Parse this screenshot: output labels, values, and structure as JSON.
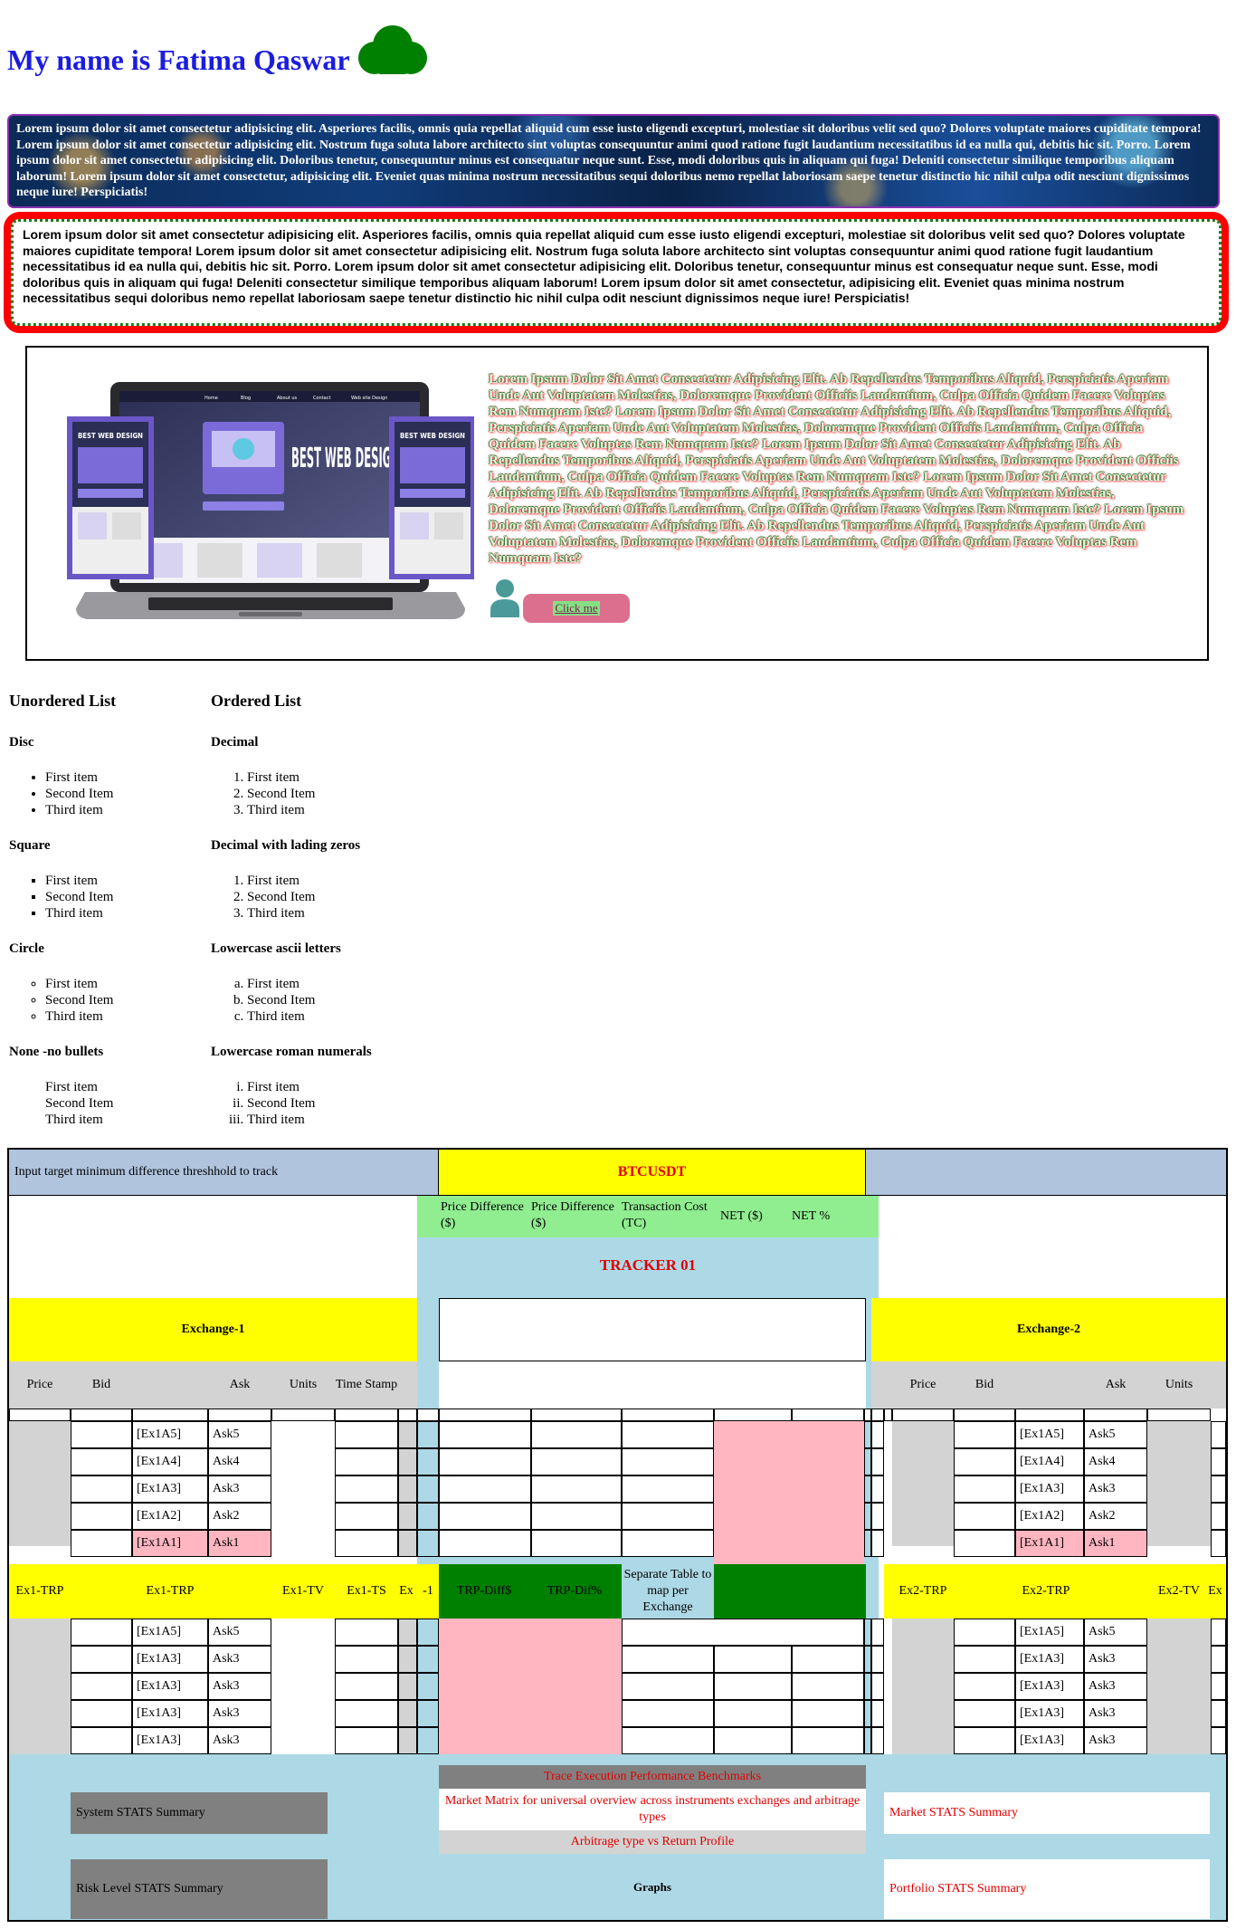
{
  "header": {
    "title": "My name is Fatima Qaswar"
  },
  "lorem_background": "Lorem ipsum dolor sit amet consectetur adipisicing elit. Asperiores facilis, omnis quia repellat aliquid cum esse iusto eligendi excepturi, molestiae sit doloribus velit sed quo? Dolores voluptate maiores cupiditate tempora! Lorem ipsum dolor sit amet consectetur adipisicing elit. Nostrum fuga soluta labore architecto sint voluptas consequuntur animi quod ratione fugit laudantium necessitatibus id ea nulla qui, debitis hic sit. Porro. Lorem ipsum dolor sit amet consectetur adipisicing elit. Doloribus tenetur, consequuntur minus est consequatur neque sunt. Esse, modi doloribus quis in aliquam qui fuga! Deleniti consectetur similique temporibus aliquam laborum! Lorem ipsum dolor sit amet consectetur, adipisicing elit. Eveniet quas minima nostrum necessitatibus sequi doloribus nemo repellat laboriosam saepe tenetur distinctio hic nihil culpa odit nesciunt dignissimos neque iure! Perspiciatis!",
  "lorem_border": "Lorem ipsum dolor sit amet consectetur adipisicing elit. Asperiores facilis, omnis quia repellat aliquid cum esse iusto eligendi excepturi, molestiae sit doloribus velit sed quo? Dolores voluptate maiores cupiditate tempora! Lorem ipsum dolor sit amet consectetur adipisicing elit. Nostrum fuga soluta labore architecto sint voluptas consequuntur animi quod ratione fugit laudantium necessitatibus id ea nulla qui, debitis hic sit. Porro. Lorem ipsum dolor sit amet consectetur adipisicing elit. Doloribus tenetur, consequuntur minus est consequatur neque sunt. Esse, modi doloribus quis in aliquam qui fuga! Deleniti consectetur similique temporibus aliquam laborum! Lorem ipsum dolor sit amet consectetur, adipisicing elit. Eveniet quas minima nostrum necessitatibus sequi doloribus nemo repellat laboriosam saepe tenetur distinctio hic nihil culpa odit nesciunt dignissimos neque iure! Perspiciatis!",
  "card": {
    "image": {
      "heading_small": "BEST WEB DESIGN",
      "heading_large": "BEST WEB DESIGN",
      "nav": [
        "Home",
        "Blog",
        "About us",
        "Contact",
        "Web site Design"
      ]
    },
    "text": "Lorem Ipsum Dolor Sit Amet Consectetur Adipisicing Elit. Ab Repellendus Temporibus Aliquid, Perspiciatis Aperiam Unde Aut Voluptatem Molestias, Doloremque Provident Officiis Laudantium, Culpa Officia Quidem Facere Voluptas Rem Numquam Iste? Lorem Ipsum Dolor Sit Amet Consectetur Adipisicing Elit. Ab Repellendus Temporibus Aliquid, Perspiciatis Aperiam Unde Aut Voluptatem Molestias, Doloremque Provident Officiis Laudantium, Culpa Officia Quidem Facere Voluptas Rem Numquam Iste? Lorem Ipsum Dolor Sit Amet Consectetur Adipisicing Elit. Ab Repellendus Temporibus Aliquid, Perspiciatis Aperiam Unde Aut Voluptatem Molestias, Doloremque Provident Officiis Laudantium, Culpa Officia Quidem Facere Voluptas Rem Numquam Iste? Lorem Ipsum Dolor Sit Amet Consectetur Adipisicing Elit. Ab Repellendus Temporibus Aliquid, Perspiciatis Aperiam Unde Aut Voluptatem Molestias, Doloremque Provident Officiis Laudantium, Culpa Officia Quidem Facere Voluptas Rem Numquam Iste? Lorem Ipsum Dolor Sit Amet Consectetur Adipisicing Elit. Ab Repellendus Temporibus Aliquid, Perspiciatis Aperiam Unde Aut Voluptatem Molestias, Doloremque Provident Officiis Laudantium, Culpa Officia Quidem Facere Voluptas Rem Numquam Iste?",
    "button_label": "Click me"
  },
  "lists": {
    "unordered_title": "Unordered List",
    "ordered_title": "Ordered List",
    "unordered": [
      {
        "title": "Disc",
        "style": "disc",
        "items": [
          "First item",
          "Second Item",
          "Third item"
        ]
      },
      {
        "title": "Square",
        "style": "square",
        "items": [
          "First item",
          "Second Item",
          "Third item"
        ]
      },
      {
        "title": "Circle",
        "style": "circle",
        "items": [
          "First item",
          "Second Item",
          "Third item"
        ]
      },
      {
        "title": "None -no bullets",
        "style": "none",
        "items": [
          "First item",
          "Second Item",
          "Third item"
        ]
      }
    ],
    "ordered": [
      {
        "title": "Decimal",
        "style": "decimal",
        "items": [
          "First item",
          "Second Item",
          "Third item"
        ]
      },
      {
        "title": "Decimal with lading zeros",
        "style": "decimal",
        "items": [
          "First item",
          "Second Item",
          "Third item"
        ]
      },
      {
        "title": "Lowercase ascii letters",
        "style": "lower-alpha",
        "items": [
          "First item",
          "Second Item",
          "Third item"
        ]
      },
      {
        "title": "Lowercase roman numerals",
        "style": "lower-roman",
        "items": [
          "First item",
          "Second Item",
          "Third item"
        ]
      }
    ]
  },
  "tracker": {
    "threshold_label": "Input target minimum difference threshhold to track",
    "pair": "BTCUSDT",
    "stat_headers": [
      "Price Difference ($)",
      "Price Difference ($)",
      "Transaction Cost (TC)",
      "NET ($)",
      "NET %"
    ],
    "tracker_title": "TRACKER 01",
    "exchange1": "Exchange-1",
    "exchange2": "Exchange-2",
    "col_headers": [
      "Price",
      "Bid",
      "Ask",
      "Units",
      "Time Stamp"
    ],
    "col_headers_ex2": [
      "Price",
      "Bid",
      "Ask",
      "Units"
    ],
    "order_rows_top": [
      [
        "[Ex1A5]",
        "Ask5"
      ],
      [
        "[Ex1A4]",
        "Ask4"
      ],
      [
        "[Ex1A3]",
        "Ask3"
      ],
      [
        "[Ex1A2]",
        "Ask2"
      ],
      [
        "[Ex1A1]",
        "Ask1"
      ]
    ],
    "order_rows_bottom": [
      [
        "[Ex1A5]",
        "Ask5"
      ],
      [
        "[Ex1A3]",
        "Ask3"
      ],
      [
        "[Ex1A3]",
        "Ask3"
      ],
      [
        "[Ex1A3]",
        "Ask3"
      ],
      [
        "[Ex1A3]",
        "Ask3"
      ]
    ],
    "ex1_bar": [
      "Ex1-TRP",
      "Ex1-TRP",
      "Ex1-TV",
      "Ex1-TS",
      "Ex",
      "-1"
    ],
    "ex2_bar": [
      "Ex2-TRP",
      "Ex2-TRP",
      "Ex2-TV",
      "Ex"
    ],
    "trp_diff": "TRP-Diff$",
    "trp_dif_pct": "TRP-Dif%",
    "separate_table": "Separate Table to map per Exchange",
    "bench_title": "Trace Execution Performance Benchmarks",
    "market_matrix": "Market Matrix for universal overview across instruments exchanges and arbitrage types",
    "arb_type": "Arbitrage type vs Return Profile",
    "graphs": "Graphs",
    "system_stats": "System STATS Summary",
    "risk_stats": "Risk Level STATS Summary",
    "market_stats": "Market STATS Summary",
    "portfolio_stats": "Portfolio STATS Summary"
  }
}
